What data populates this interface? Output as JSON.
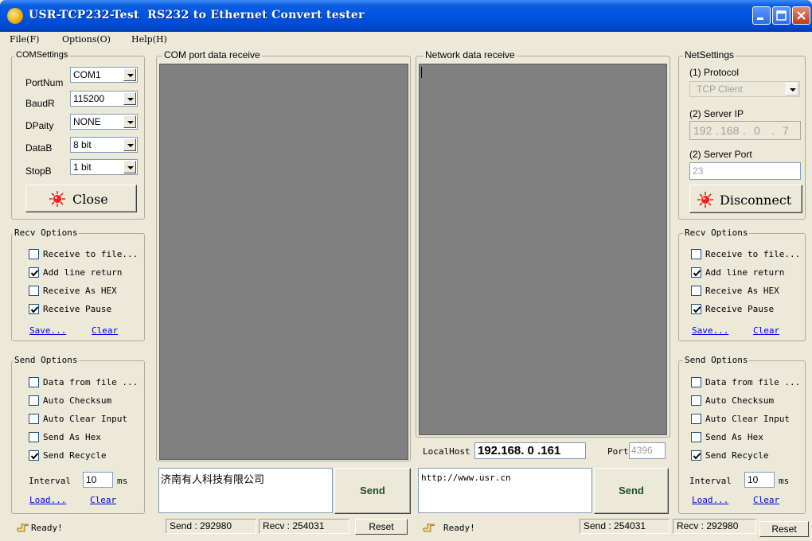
{
  "window": {
    "title": "USR-TCP232-Test  RS232 to Ethernet Convert tester",
    "accent": "#0054e3"
  },
  "menu": {
    "file": "File(F)",
    "options": "Options(O)",
    "help": "Help(H)"
  },
  "com_settings": {
    "title": "COMSettings",
    "portnum_label": "PortNum",
    "portnum": "COM1",
    "baud_label": "BaudR",
    "baud": "115200",
    "parity_label": "DPaity",
    "parity": "NONE",
    "databits_label": "DataB",
    "databits": "8 bit",
    "stopbits_label": "StopB",
    "stopbits": "1 bit",
    "close_button": "Close"
  },
  "left_recv_options": {
    "title": "Recv Options",
    "receive_to_file": "Receive to file...",
    "add_line_return": "Add line return",
    "receive_as_hex": "Receive As HEX",
    "receive_pause": "Receive Pause",
    "save": "Save...",
    "clear": "Clear"
  },
  "left_send_options": {
    "title": "Send Options",
    "data_from_file": "Data from file ...",
    "auto_checksum": "Auto Checksum",
    "auto_clear_input": "Auto Clear Input",
    "send_as_hex": "Send As Hex",
    "send_recycle": "Send Recycle",
    "interval_label": "Interval",
    "interval": "10",
    "interval_unit": "ms",
    "load": "Load...",
    "clear": "Clear"
  },
  "com_receive": {
    "title": "COM port data receive",
    "send_text": "济南有人科技有限公司",
    "send_button": "Send"
  },
  "network_receive": {
    "title": "Network data receive",
    "localhost_label": "LocalHost",
    "localhost_ip": "192.168. 0 .161",
    "port_label": "Port",
    "port": "4396",
    "send_text": "http://www.usr.cn",
    "send_button": "Send"
  },
  "net_settings": {
    "title": "NetSettings",
    "protocol_label": "(1) Protocol",
    "protocol": "TCP Client",
    "server_ip_label": "(2) Server IP",
    "ip1": "192",
    "ip2": "168",
    "ip3": "0",
    "ip4": "7",
    "server_port_label": "(2) Server Port",
    "server_port": "23",
    "disconnect_button": "Disconnect"
  },
  "right_recv_options": {
    "title": "Recv Options",
    "receive_to_file": "Receive to file...",
    "add_line_return": "Add line return",
    "receive_as_hex": "Receive As HEX",
    "receive_pause": "Receive Pause",
    "save": "Save...",
    "clear": "Clear"
  },
  "right_send_options": {
    "title": "Send Options",
    "data_from_file": "Data from file ...",
    "auto_checksum": "Auto Checksum",
    "auto_clear_input": "Auto Clear Input",
    "send_as_hex": "Send As Hex",
    "send_recycle": "Send Recycle",
    "interval_label": "Interval",
    "interval": "10",
    "interval_unit": "ms",
    "load": "Load...",
    "clear": "Clear"
  },
  "status": {
    "left_ready": "Ready!",
    "left_send": "Send : 292980",
    "left_recv": "Recv : 254031",
    "left_reset": "Reset",
    "right_ready": "Ready!",
    "right_send": "Send : 254031",
    "right_recv": "Recv : 292980",
    "right_reset": "Reset"
  },
  "checkbox_states": {
    "receive_to_file": false,
    "add_line_return": true,
    "receive_as_hex": false,
    "receive_pause": true,
    "data_from_file": false,
    "auto_checksum": false,
    "auto_clear_input": false,
    "send_as_hex": false,
    "send_recycle": true
  },
  "icons": {
    "app": "usr-app-icon",
    "led": "red-led-icon",
    "hand": "hand-pointer-icon",
    "minimize": "minimize-icon",
    "maximize": "maximize-icon",
    "close": "close-icon"
  }
}
